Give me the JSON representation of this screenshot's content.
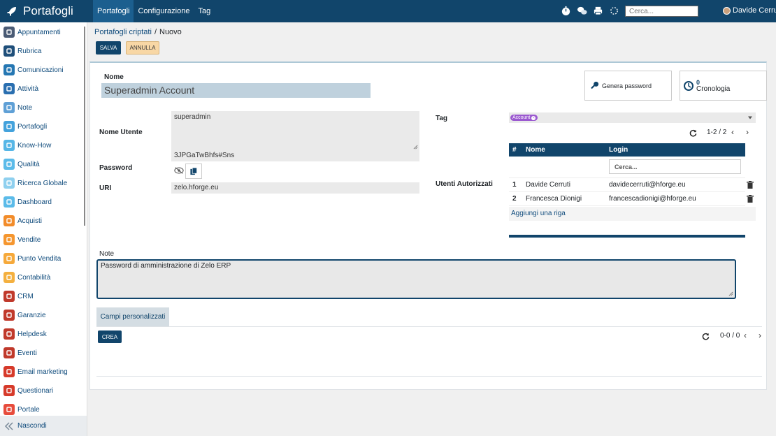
{
  "app": {
    "title": "Portafogli"
  },
  "topnav": [
    {
      "label": "Portafogli",
      "active": true
    },
    {
      "label": "Configurazione",
      "active": false
    },
    {
      "label": "Tag",
      "active": false
    }
  ],
  "top_search_placeholder": "Cerca...",
  "user_name": "Davide Cerruti",
  "sidebar": {
    "items": [
      {
        "label": "Appuntamenti",
        "color": "#4a5b75",
        "icon": "calendar-icon"
      },
      {
        "label": "Rubrica",
        "color": "#1f4f7a",
        "icon": "contacts-icon"
      },
      {
        "label": "Comunicazioni",
        "color": "#2577b3",
        "icon": "chat-icon"
      },
      {
        "label": "Attività",
        "color": "#2a6fb0",
        "icon": "check-icon"
      },
      {
        "label": "Note",
        "color": "#5fa0d6",
        "icon": "note-icon"
      },
      {
        "label": "Portafogli",
        "color": "#43a2dc",
        "icon": "lock-icon"
      },
      {
        "label": "Know-How",
        "color": "#56b6e6",
        "icon": "lightbulb-icon"
      },
      {
        "label": "Qualità",
        "color": "#5bbbe9",
        "icon": "quality-icon"
      },
      {
        "label": "Ricerca Globale",
        "color": "#8fd0ef",
        "icon": "search-icon"
      },
      {
        "label": "Dashboard",
        "color": "#5bbbe9",
        "icon": "dashboard-icon"
      },
      {
        "label": "Acquisti",
        "color": "#f28c2a",
        "icon": "cart-icon"
      },
      {
        "label": "Vendite",
        "color": "#f5962f",
        "icon": "chart-icon"
      },
      {
        "label": "Punto Vendita",
        "color": "#f6a93a",
        "icon": "store-icon"
      },
      {
        "label": "Contabilità",
        "color": "#f4b03f",
        "icon": "accounting-icon"
      },
      {
        "label": "CRM",
        "color": "#c0392b",
        "icon": "handshake-icon"
      },
      {
        "label": "Garanzie",
        "color": "#c0392b",
        "icon": "shield-icon"
      },
      {
        "label": "Helpdesk",
        "color": "#c0392b",
        "icon": "headset-icon"
      },
      {
        "label": "Eventi",
        "color": "#c0392b",
        "icon": "ticket-icon"
      },
      {
        "label": "Email marketing",
        "color": "#d63a2a",
        "icon": "email-icon"
      },
      {
        "label": "Questionari",
        "color": "#d63a2a",
        "icon": "survey-icon"
      },
      {
        "label": "Portale",
        "color": "#e74c3c",
        "icon": "portal-icon"
      }
    ],
    "hide_label": "Nascondi"
  },
  "breadcrumb": {
    "parent": "Portafogli criptati",
    "current": "Nuovo"
  },
  "buttons": {
    "save": "SALVA",
    "discard": "ANNULLA",
    "create": "CREA"
  },
  "form": {
    "name_label": "Nome",
    "name_value": "Superadmin Account",
    "username_label": "Nome Utente",
    "username_value": "superadmin",
    "password_label": "Password",
    "password_value": "3JPGaTwBhfs#Sns",
    "uri_label": "URI",
    "uri_value": "zelo.hforge.eu",
    "tag_label": "Tag",
    "tag_value": "Account",
    "users_label": "Utenti Autorizzati",
    "notes_label": "Note",
    "notes_value": "Password di amministrazione di Zelo ERP",
    "custom_fields_label": "Campi personalizzati"
  },
  "smart_buttons": {
    "gen_password": "Genera password",
    "history_count": "0",
    "history_label": "Cronologia"
  },
  "users_table": {
    "pager": "1-2 / 2",
    "columns": [
      "#",
      "Nome",
      "Login"
    ],
    "search_placeholder": "Cerca...",
    "rows": [
      {
        "num": "1",
        "name": "Davide Cerruti",
        "login": "davidecerruti@hforge.eu"
      },
      {
        "num": "2",
        "name": "Francesca Dionigi",
        "login": "francescadionigi@hforge.eu"
      }
    ],
    "add_row": "Aggiungi una riga"
  },
  "bottom_pager": "0-0 / 0"
}
